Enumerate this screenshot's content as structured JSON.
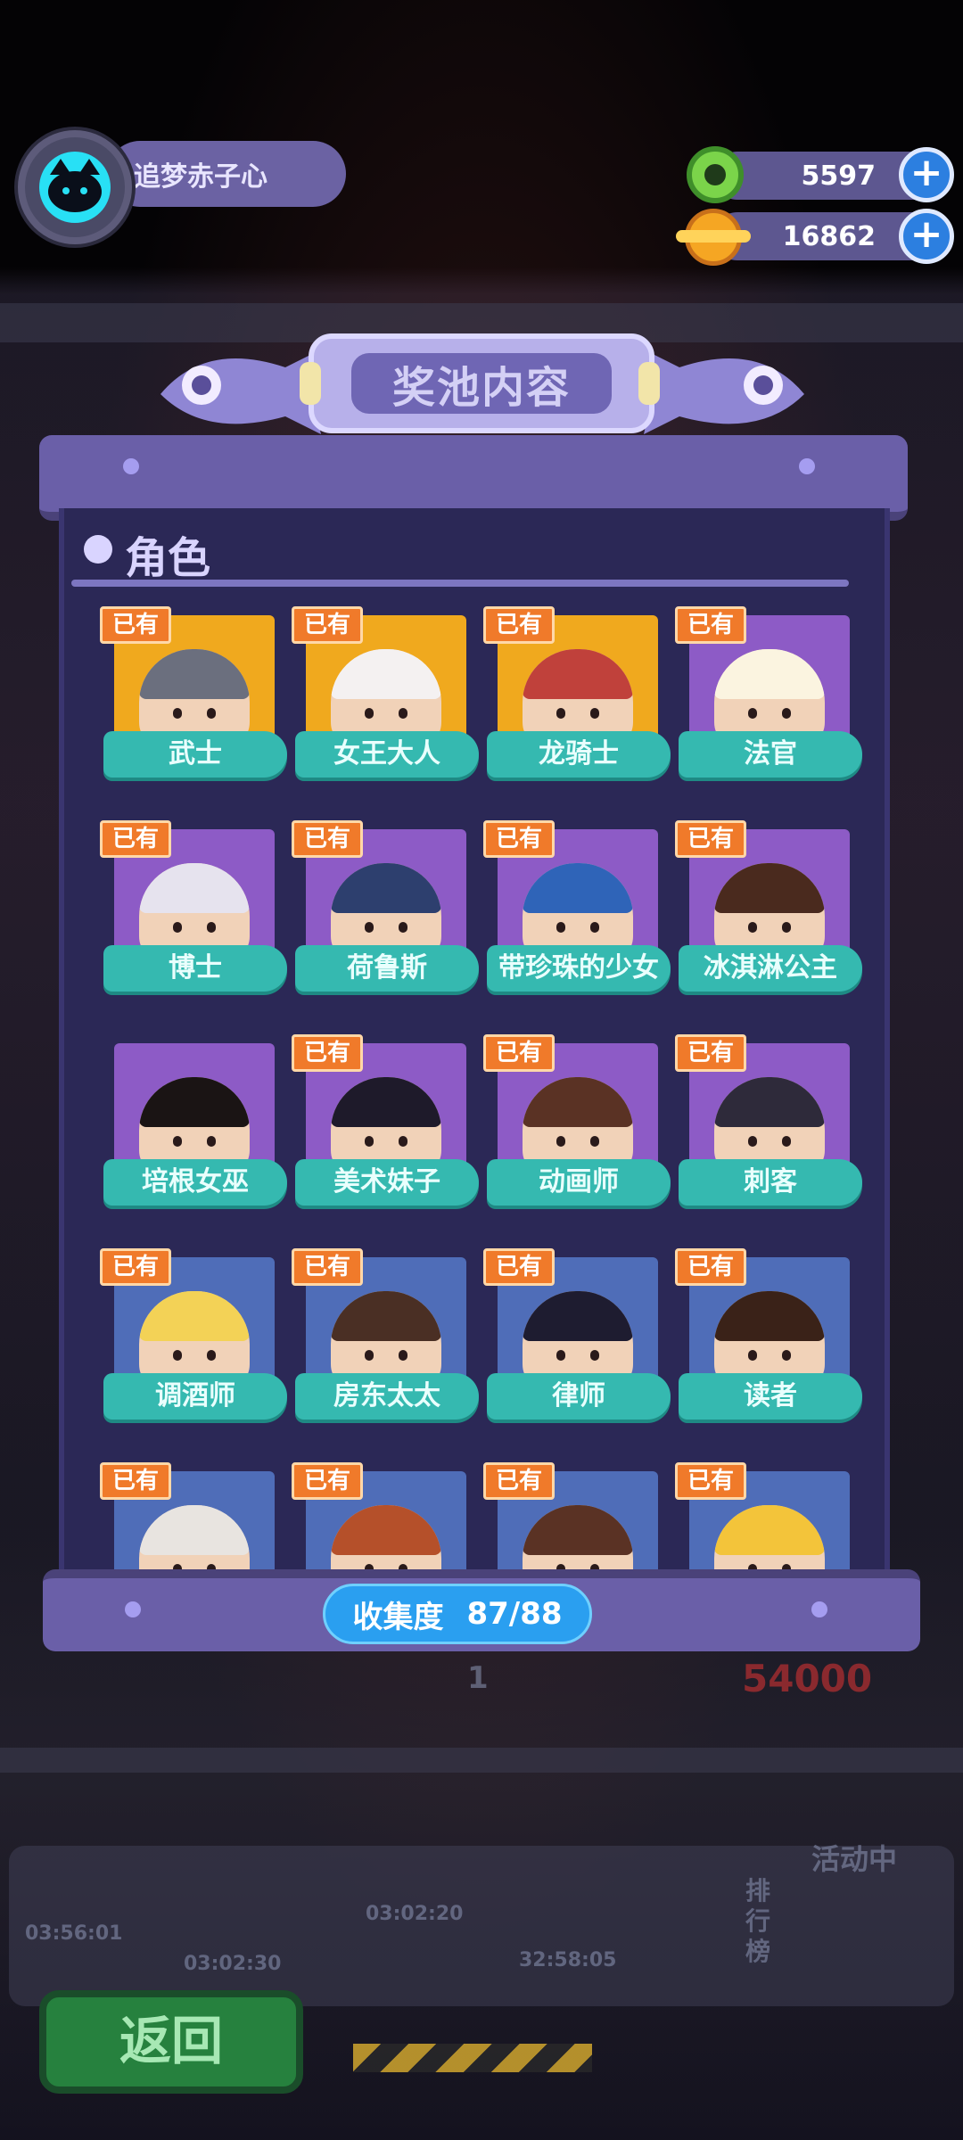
{
  "player": {
    "name": "追梦赤子心"
  },
  "currency": [
    {
      "icon": "green-donut-icon",
      "value": "5597",
      "color": "#7bd44a"
    },
    {
      "icon": "orange-planet-coin-icon",
      "value": "16862",
      "color": "#f5a623"
    }
  ],
  "modal": {
    "title": "奖池内容",
    "section_title": "角色",
    "owned_badge": "已有",
    "characters": [
      {
        "name": "武士",
        "owned": true,
        "bg": "#f0a91e",
        "hair": "#6b6f7e"
      },
      {
        "name": "女王大人",
        "owned": true,
        "bg": "#f0a91e",
        "hair": "#f4f1f1"
      },
      {
        "name": "龙骑士",
        "owned": true,
        "bg": "#f0a91e",
        "hair": "#c0413b"
      },
      {
        "name": "法官",
        "owned": true,
        "bg": "#8d5bc6",
        "hair": "#fbf4e0"
      },
      {
        "name": "博士",
        "owned": true,
        "bg": "#8d5bc6",
        "hair": "#e6e3ee"
      },
      {
        "name": "荷鲁斯",
        "owned": true,
        "bg": "#8d5bc6",
        "hair": "#2d3f6e"
      },
      {
        "name": "带珍珠的少女",
        "owned": true,
        "bg": "#8d5bc6",
        "hair": "#2f64b8"
      },
      {
        "name": "冰淇淋公主",
        "owned": true,
        "bg": "#8d5bc6",
        "hair": "#4a2a1e"
      },
      {
        "name": "培根女巫",
        "owned": false,
        "bg": "#8d5bc6",
        "hair": "#1a1414"
      },
      {
        "name": "美术妹子",
        "owned": true,
        "bg": "#8d5bc6",
        "hair": "#1e1a2a"
      },
      {
        "name": "动画师",
        "owned": true,
        "bg": "#8d5bc6",
        "hair": "#5a3224"
      },
      {
        "name": "刺客",
        "owned": true,
        "bg": "#8d5bc6",
        "hair": "#2e2a3a"
      },
      {
        "name": "调酒师",
        "owned": true,
        "bg": "#4f6db8",
        "hair": "#f3d256"
      },
      {
        "name": "房东太太",
        "owned": true,
        "bg": "#4f6db8",
        "hair": "#4a2f24"
      },
      {
        "name": "律师",
        "owned": true,
        "bg": "#4f6db8",
        "hair": "#1e1c30"
      },
      {
        "name": "读者",
        "owned": true,
        "bg": "#4f6db8",
        "hair": "#3a2218"
      },
      {
        "name": "",
        "owned": true,
        "bg": "#4f6db8",
        "hair": "#e8e4e0"
      },
      {
        "name": "",
        "owned": true,
        "bg": "#4f6db8",
        "hair": "#b5502a"
      },
      {
        "name": "",
        "owned": true,
        "bg": "#4f6db8",
        "hair": "#5a3224"
      },
      {
        "name": "",
        "owned": true,
        "bg": "#4f6db8",
        "hair": "#f3c43a"
      }
    ]
  },
  "collection": {
    "label": "收集度",
    "value": "87/88"
  },
  "background": {
    "prize_count": "1",
    "prize_coins": "54000",
    "event_label": "活动中",
    "rank_label": "排行榜",
    "timers": [
      "03:56:01",
      "03:02:30",
      "03:02:20",
      "32:58:05"
    ]
  },
  "back_button": {
    "label": "返回"
  }
}
